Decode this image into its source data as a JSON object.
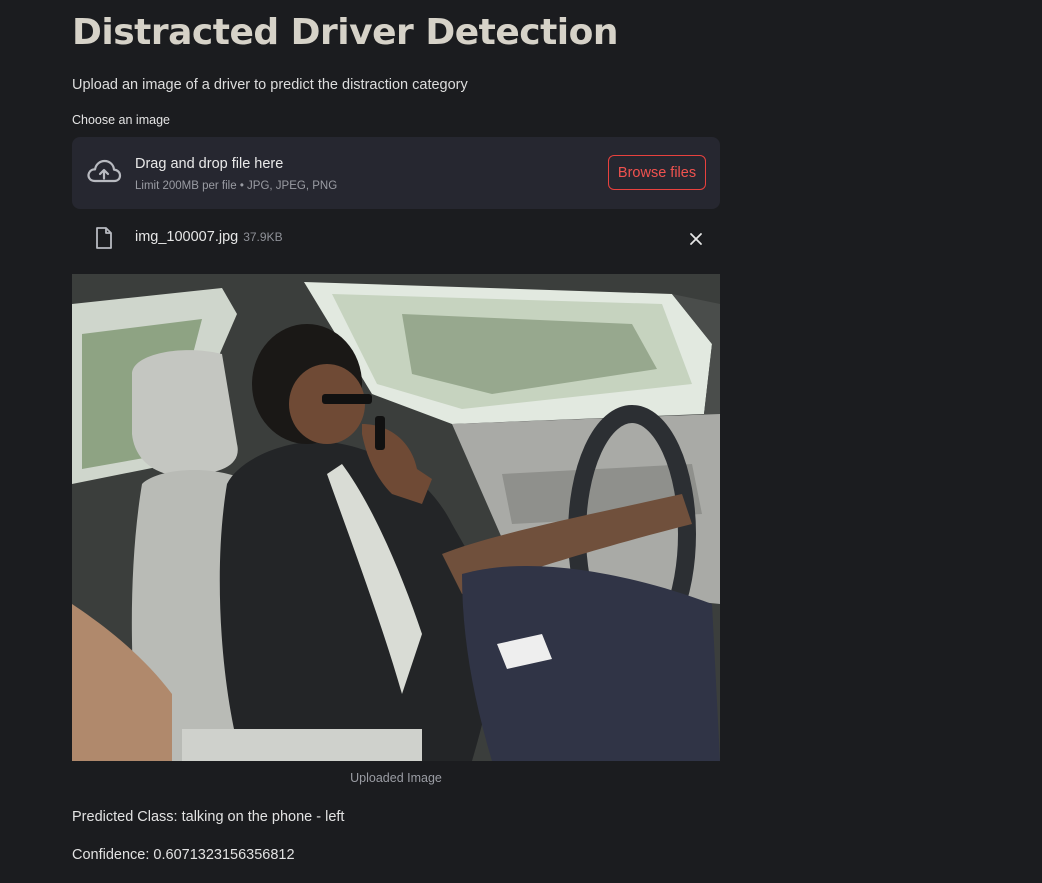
{
  "app": {
    "title": "Distracted Driver Detection",
    "subtitle": "Upload an image of a driver to predict the distraction category"
  },
  "uploader": {
    "label": "Choose an image",
    "drag_text": "Drag and drop file here",
    "limit_text": "Limit 200MB per file • JPG, JPEG, PNG",
    "browse_label": "Browse files",
    "cloud_icon": "cloud-upload-icon"
  },
  "uploaded_file": {
    "name": "img_100007.jpg",
    "size": "37.9KB",
    "file_icon": "file-icon",
    "remove_icon": "close-icon"
  },
  "image": {
    "caption": "Uploaded Image",
    "alt": "Driver in car seat holding a phone to his ear with the right hand while steering"
  },
  "result": {
    "predicted_class": "Predicted Class: talking on the phone - left",
    "confidence": "Confidence: 0.6071323156356812"
  },
  "colors": {
    "background": "#1b1c1f",
    "panel": "#262730",
    "accent": "#e8413e",
    "title": "#d6d2c8"
  }
}
